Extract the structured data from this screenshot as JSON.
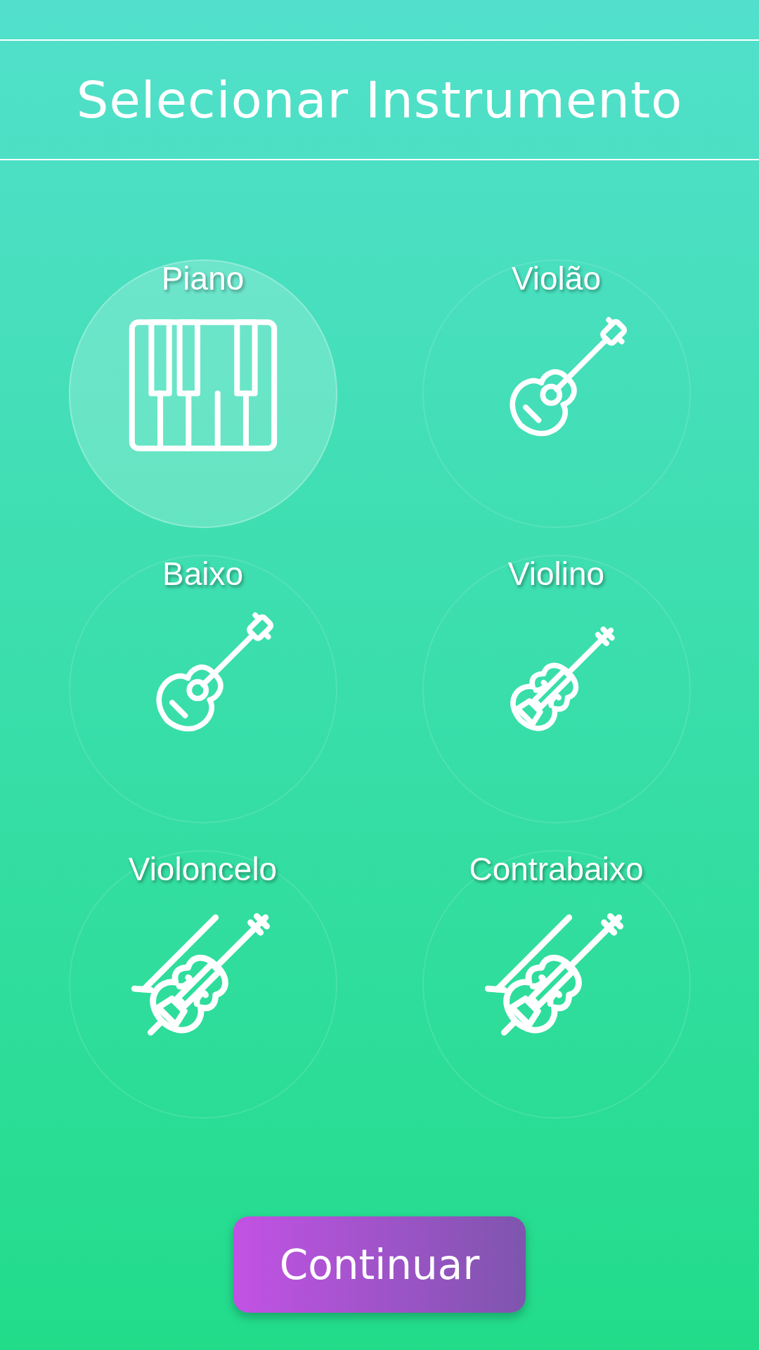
{
  "header": {
    "title": "Selecionar Instrumento"
  },
  "instruments": [
    {
      "name": "Piano",
      "kind": "piano",
      "selected": true
    },
    {
      "name": "Violão",
      "kind": "guitar",
      "selected": false
    },
    {
      "name": "Baixo",
      "kind": "bass",
      "selected": false
    },
    {
      "name": "Violino",
      "kind": "violin",
      "selected": false
    },
    {
      "name": "Violoncelo",
      "kind": "cello",
      "selected": false
    },
    {
      "name": "Contrabaixo",
      "kind": "contrabass",
      "selected": false
    }
  ],
  "continue_button": {
    "label": "Continuar"
  }
}
